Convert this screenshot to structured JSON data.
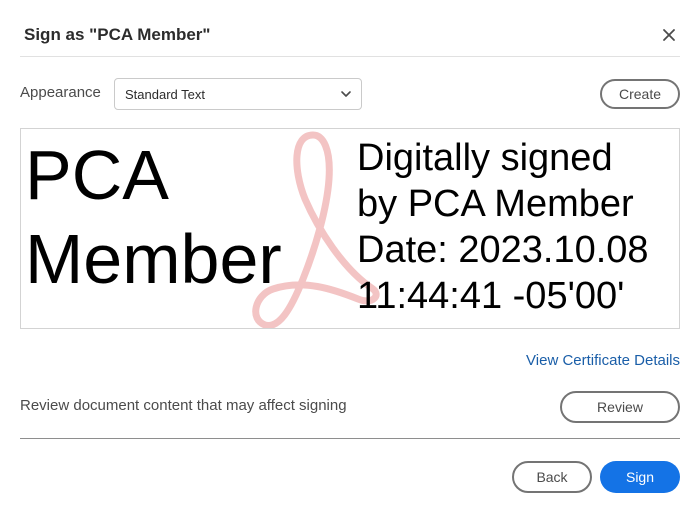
{
  "dialog": {
    "title": "Sign as \"PCA Member\"",
    "close_icon": "close-icon"
  },
  "appearance": {
    "label": "Appearance",
    "selected": "Standard Text",
    "create_label": "Create"
  },
  "preview": {
    "name_lines": [
      "PCA",
      "Member"
    ],
    "detail_lines": [
      "Digitally signed",
      "by PCA Member",
      "Date: 2023.10.08",
      "11:44:41 -05'00'"
    ],
    "watermark_icon": "acrobat-logo-icon",
    "watermark_color": "#f3c4c4"
  },
  "certificate": {
    "link_label": "View Certificate Details"
  },
  "review": {
    "text": "Review document content that may affect signing",
    "button_label": "Review"
  },
  "footer": {
    "back_label": "Back",
    "sign_label": "Sign",
    "sign_color": "#1473e6"
  }
}
